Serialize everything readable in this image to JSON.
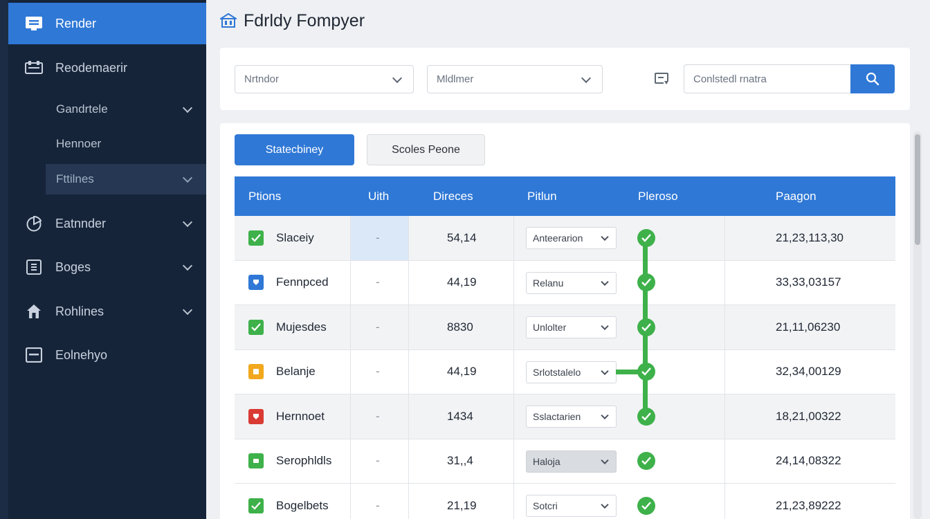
{
  "sidebar": {
    "active": {
      "label": "Render",
      "icon": "inbox-icon"
    },
    "items": [
      {
        "label": "Reodemaerir",
        "icon": "dashboard-icon"
      },
      {
        "label": "Gandrtele"
      },
      {
        "label": "Hennoer"
      },
      {
        "label": "Fttilnes"
      },
      {
        "label": "Eatnnder",
        "icon": "chart-icon"
      },
      {
        "label": "Boges",
        "icon": "box-icon"
      },
      {
        "label": "Rohlines",
        "icon": "home-icon"
      },
      {
        "label": "Eolnehyo",
        "icon": "window-icon"
      }
    ]
  },
  "header": {
    "title": "Fdrldy Fompyer",
    "icon": "building-icon"
  },
  "filters": {
    "dropdown1": "Nrtndor",
    "dropdown2": "Mldlmer",
    "search_placeholder": "Conlstedl rnatra"
  },
  "tabs": {
    "primary": "Statecbiney",
    "secondary": "Scoles Peone"
  },
  "table": {
    "headers": {
      "c1": "Ptions",
      "c2": "Uith",
      "c3": "Direces",
      "c4": "Pitlun",
      "c5": "Pleroso",
      "c6": "Paagon"
    },
    "rows": [
      {
        "name": "Slaceiy",
        "unit": "-",
        "value": "54,14",
        "option": "Anteerarion",
        "total": "21,23,113,30",
        "status_color": "#3eb14a"
      },
      {
        "name": "Fennpced",
        "unit": "-",
        "value": "44,19",
        "option": "Relanu",
        "total": "33,33,03157",
        "status_color": "#2f78d6"
      },
      {
        "name": "Mujesdes",
        "unit": "-",
        "value": "8830",
        "option": "Unlolter",
        "total": "21,11,06230",
        "status_color": "#3eb14a"
      },
      {
        "name": "Belanje",
        "unit": "-",
        "value": "44,19",
        "option": "Srlotstalelo",
        "total": "32,34,00129",
        "status_color": "#f2a81c"
      },
      {
        "name": "Hernnoet",
        "unit": "-",
        "value": "1434",
        "option": "Sslactarien",
        "total": "18,21,00322",
        "status_color": "#d93b34"
      },
      {
        "name": "Serophldls",
        "unit": "-",
        "value": "31,,4",
        "option": "Haloja",
        "total": "24,14,08322",
        "status_color": "#3eb14a"
      },
      {
        "name": "Bogelbets",
        "unit": "-",
        "value": "21,19",
        "option": "Sotcri",
        "total": "21,23,89222",
        "status_color": "#3eb14a"
      }
    ]
  },
  "colors": {
    "accent": "#2f78d6",
    "sidebar_bg": "#16243a",
    "success": "#3eb14a"
  }
}
